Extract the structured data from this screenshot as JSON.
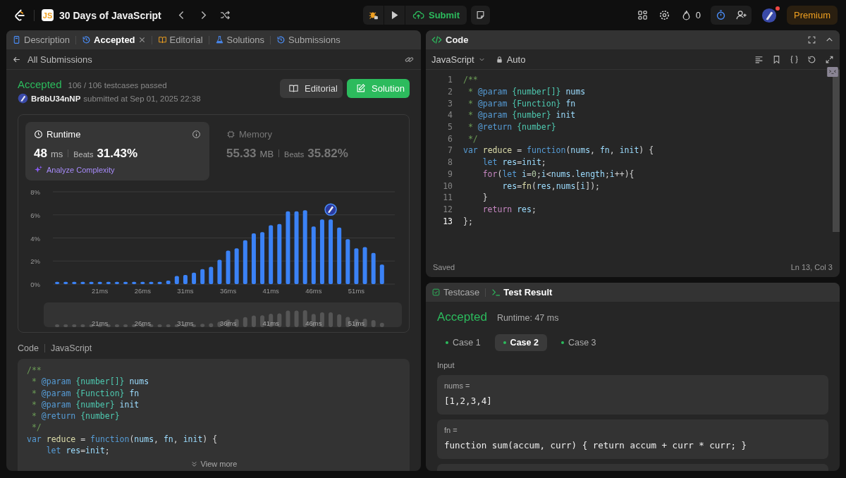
{
  "topbar": {
    "badge_text": "JS",
    "title": "30 Days of JavaScript",
    "submit": "Submit",
    "streak": "0",
    "premium": "Premium",
    "has_notification": true
  },
  "left_tabs": [
    {
      "label": "Description",
      "kind": "description",
      "selected": false,
      "closable": false
    },
    {
      "label": "Accepted",
      "kind": "history",
      "selected": true,
      "closable": true
    },
    {
      "label": "Editorial",
      "kind": "book",
      "selected": false,
      "closable": false
    },
    {
      "label": "Solutions",
      "kind": "flask",
      "selected": false,
      "closable": false
    },
    {
      "label": "Submissions",
      "kind": "history",
      "selected": false,
      "closable": false
    }
  ],
  "submission": {
    "back_label": "All Submissions",
    "status": "Accepted",
    "testcases": "106 / 106 testcases passed",
    "user": "Br8bU34nNP",
    "submitted": "submitted at Sep 01, 2025 22:38",
    "buttons": [
      {
        "label": "Editorial",
        "kind": "secondary"
      },
      {
        "label": "Solution",
        "kind": "primary"
      }
    ]
  },
  "stats": [
    {
      "kind": "runtime",
      "title": "Runtime",
      "value": "48",
      "unit": "ms",
      "beats_label": "Beats",
      "beats": "31.43%",
      "selected": true,
      "link": "Analyze Complexity"
    },
    {
      "kind": "memory",
      "title": "Memory",
      "value": "55.33",
      "unit": "MB",
      "beats_label": "Beats",
      "beats": "35.82%",
      "selected": false
    }
  ],
  "chart_data": {
    "type": "bar",
    "x": [
      16,
      17,
      18,
      19,
      20,
      21,
      22,
      23,
      24,
      25,
      26,
      27,
      28,
      29,
      30,
      31,
      32,
      33,
      34,
      35,
      36,
      37,
      38,
      39,
      40,
      41,
      42,
      43,
      44,
      45,
      46,
      47,
      48,
      49,
      50,
      51,
      52,
      53,
      54
    ],
    "series": [
      {
        "color": "#3b82f6",
        "values": [
          0.2,
          0.2,
          0.2,
          0.2,
          0.2,
          0.2,
          0.2,
          0.2,
          0.2,
          0.2,
          0.2,
          0.2,
          0.2,
          0.3,
          0.7,
          0.8,
          1.0,
          1.3,
          1.5,
          2.1,
          2.9,
          3.1,
          3.8,
          4.4,
          4.5,
          5.1,
          5.2,
          6.3,
          6.3,
          6.4,
          5.0,
          5.6,
          5.6,
          4.9,
          3.9,
          3.1,
          3.2,
          2.7,
          1.7
        ]
      }
    ],
    "xlim": [
      15.5,
      55.5
    ],
    "ylim": [
      0,
      8
    ],
    "grid": true,
    "yticks": [
      {
        "value": 0,
        "label": "0%"
      },
      {
        "value": 2,
        "label": "2%"
      },
      {
        "value": 4,
        "label": "4%"
      },
      {
        "value": 6,
        "label": "6%"
      },
      {
        "value": 8,
        "label": "8%"
      }
    ],
    "xticks": [
      {
        "value": 21,
        "label": "21ms"
      },
      {
        "value": 26,
        "label": "26ms"
      },
      {
        "value": 31,
        "label": "31ms"
      },
      {
        "value": 36,
        "label": "36ms"
      },
      {
        "value": 41,
        "label": "41ms"
      },
      {
        "value": 46,
        "label": "46ms"
      },
      {
        "value": 51,
        "label": "51ms"
      }
    ]
  },
  "overview": {
    "tick_labels": [
      "21ms",
      "26ms",
      "31ms",
      "36ms",
      "41ms",
      "46ms",
      "51ms"
    ]
  },
  "code_preview": {
    "label": "Code",
    "language": "JavaScript",
    "more": "View more",
    "lines": [
      {
        "tokens": [
          {
            "kind": "cm",
            "text": "/**"
          }
        ]
      },
      {
        "tokens": [
          {
            "kind": "cm",
            "text": " * "
          },
          {
            "kind": "tag",
            "text": "@param "
          },
          {
            "kind": "type",
            "text": "{number[]}"
          },
          {
            "kind": "id",
            "text": " nums"
          }
        ]
      },
      {
        "tokens": [
          {
            "kind": "cm",
            "text": " * "
          },
          {
            "kind": "tag",
            "text": "@param "
          },
          {
            "kind": "type",
            "text": "{Function}"
          },
          {
            "kind": "id",
            "text": " fn"
          }
        ]
      },
      {
        "tokens": [
          {
            "kind": "cm",
            "text": " * "
          },
          {
            "kind": "tag",
            "text": "@param "
          },
          {
            "kind": "type",
            "text": "{number}"
          },
          {
            "kind": "id",
            "text": " init"
          }
        ]
      },
      {
        "tokens": [
          {
            "kind": "cm",
            "text": " * "
          },
          {
            "kind": "tag",
            "text": "@return "
          },
          {
            "kind": "type",
            "text": "{number}"
          }
        ]
      },
      {
        "tokens": [
          {
            "kind": "cm",
            "text": " */"
          }
        ]
      },
      {
        "tokens": [
          {
            "kind": "kw",
            "text": "var "
          },
          {
            "kind": "fn",
            "text": "reduce"
          },
          {
            "kind": "p",
            "text": " = "
          },
          {
            "kind": "kw",
            "text": "function"
          },
          {
            "kind": "p",
            "text": "("
          },
          {
            "kind": "id",
            "text": "nums"
          },
          {
            "kind": "p",
            "text": ", "
          },
          {
            "kind": "id",
            "text": "fn"
          },
          {
            "kind": "p",
            "text": ", "
          },
          {
            "kind": "id",
            "text": "init"
          },
          {
            "kind": "p",
            "text": ") {"
          }
        ]
      },
      {
        "tokens": [
          {
            "kind": "kw",
            "text": "    let "
          },
          {
            "kind": "id",
            "text": "res"
          },
          {
            "kind": "p",
            "text": "="
          },
          {
            "kind": "id",
            "text": "init"
          },
          {
            "kind": "p",
            "text": ";"
          }
        ]
      }
    ]
  },
  "editor": {
    "title": "Code",
    "language": "JavaScript",
    "mode": "Auto",
    "status": "Saved",
    "cursor": "Ln 13, Col 3",
    "lines": [
      {
        "number": "1",
        "current": false,
        "tokens": [
          {
            "kind": "cm",
            "text": "/**"
          }
        ]
      },
      {
        "number": "2",
        "current": false,
        "tokens": [
          {
            "kind": "cm",
            "text": " * "
          },
          {
            "kind": "tag",
            "text": "@param "
          },
          {
            "kind": "type",
            "text": "{number[]}"
          },
          {
            "kind": "id",
            "text": " nums"
          }
        ]
      },
      {
        "number": "3",
        "current": false,
        "tokens": [
          {
            "kind": "cm",
            "text": " * "
          },
          {
            "kind": "tag",
            "text": "@param "
          },
          {
            "kind": "type",
            "text": "{Function}"
          },
          {
            "kind": "id",
            "text": " fn"
          }
        ]
      },
      {
        "number": "4",
        "current": false,
        "tokens": [
          {
            "kind": "cm",
            "text": " * "
          },
          {
            "kind": "tag",
            "text": "@param "
          },
          {
            "kind": "type",
            "text": "{number}"
          },
          {
            "kind": "id",
            "text": " init"
          }
        ]
      },
      {
        "number": "5",
        "current": false,
        "tokens": [
          {
            "kind": "cm",
            "text": " * "
          },
          {
            "kind": "tag",
            "text": "@return "
          },
          {
            "kind": "type",
            "text": "{number}"
          }
        ]
      },
      {
        "number": "6",
        "current": false,
        "tokens": [
          {
            "kind": "cm",
            "text": " */"
          }
        ]
      },
      {
        "number": "7",
        "current": false,
        "tokens": [
          {
            "kind": "kw",
            "text": "var "
          },
          {
            "kind": "fn",
            "text": "reduce"
          },
          {
            "kind": "p",
            "text": " = "
          },
          {
            "kind": "kw",
            "text": "function"
          },
          {
            "kind": "p",
            "text": "("
          },
          {
            "kind": "id",
            "text": "nums"
          },
          {
            "kind": "p",
            "text": ", "
          },
          {
            "kind": "id",
            "text": "fn"
          },
          {
            "kind": "p",
            "text": ", "
          },
          {
            "kind": "id",
            "text": "init"
          },
          {
            "kind": "p",
            "text": ") {"
          }
        ]
      },
      {
        "number": "8",
        "current": false,
        "tokens": [
          {
            "kind": "kw",
            "text": "    let "
          },
          {
            "kind": "id",
            "text": "res"
          },
          {
            "kind": "p",
            "text": "="
          },
          {
            "kind": "id",
            "text": "init"
          },
          {
            "kind": "p",
            "text": ";"
          }
        ]
      },
      {
        "number": "9",
        "current": false,
        "tokens": [
          {
            "kind": "ctl",
            "text": "    for"
          },
          {
            "kind": "p",
            "text": "("
          },
          {
            "kind": "kw",
            "text": "let "
          },
          {
            "kind": "id",
            "text": "i"
          },
          {
            "kind": "p",
            "text": "="
          },
          {
            "kind": "num",
            "text": "0"
          },
          {
            "kind": "p",
            "text": ";"
          },
          {
            "kind": "id",
            "text": "i"
          },
          {
            "kind": "p",
            "text": "<"
          },
          {
            "kind": "id",
            "text": "nums"
          },
          {
            "kind": "p",
            "text": "."
          },
          {
            "kind": "id",
            "text": "length"
          },
          {
            "kind": "p",
            "text": ";"
          },
          {
            "kind": "id",
            "text": "i"
          },
          {
            "kind": "p",
            "text": "++){"
          }
        ]
      },
      {
        "number": "10",
        "current": false,
        "tokens": [
          {
            "kind": "id",
            "text": "        res"
          },
          {
            "kind": "p",
            "text": "="
          },
          {
            "kind": "fn",
            "text": "fn"
          },
          {
            "kind": "p",
            "text": "("
          },
          {
            "kind": "id",
            "text": "res"
          },
          {
            "kind": "p",
            "text": ","
          },
          {
            "kind": "id",
            "text": "nums"
          },
          {
            "kind": "p",
            "text": "["
          },
          {
            "kind": "id",
            "text": "i"
          },
          {
            "kind": "p",
            "text": "]);"
          }
        ]
      },
      {
        "number": "11",
        "current": false,
        "tokens": [
          {
            "kind": "p",
            "text": "    }"
          }
        ]
      },
      {
        "number": "12",
        "current": false,
        "tokens": [
          {
            "kind": "ctl",
            "text": "    return "
          },
          {
            "kind": "id",
            "text": "res"
          },
          {
            "kind": "p",
            "text": ";"
          }
        ]
      },
      {
        "number": "13",
        "current": true,
        "tokens": [
          {
            "kind": "p",
            "text": "};"
          }
        ]
      }
    ]
  },
  "tests": {
    "tabs": [
      {
        "label": "Testcase",
        "kind": "testcase",
        "selected": false
      },
      {
        "label": "Test Result",
        "kind": "result",
        "selected": true
      }
    ],
    "status": "Accepted",
    "runtime": "Runtime: 47 ms",
    "cases": [
      {
        "label": "Case 1",
        "selected": false,
        "passed": true
      },
      {
        "label": "Case 2",
        "selected": true,
        "passed": true
      },
      {
        "label": "Case 3",
        "selected": false,
        "passed": true
      }
    ],
    "input_label": "Input",
    "inputs": [
      {
        "name": "nums =",
        "value": "[1,2,3,4]"
      },
      {
        "name": "fn =",
        "value": "function sum(accum, curr) { return accum + curr * curr; }"
      }
    ]
  }
}
